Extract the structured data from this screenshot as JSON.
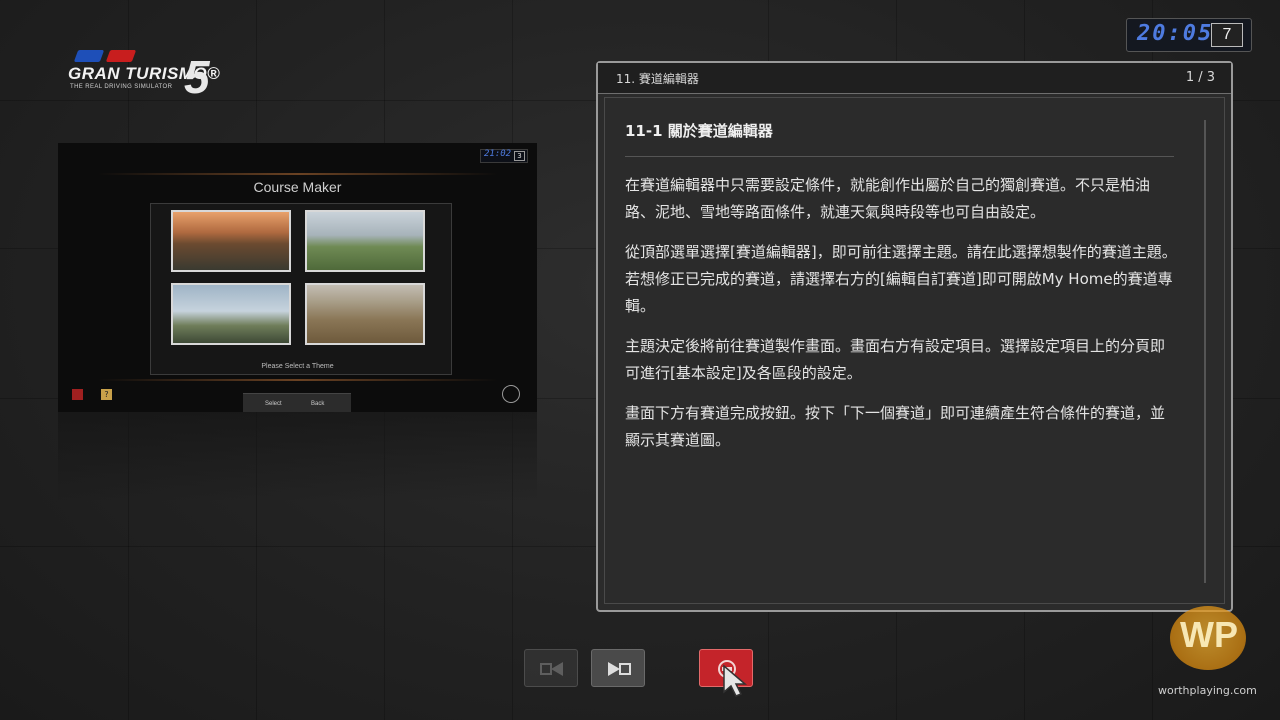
{
  "logo": {
    "brand": "GRAN TURISMO®",
    "subtitle": "THE REAL DRIVING SIMULATOR",
    "number": "5"
  },
  "clock": {
    "time": "20:05",
    "day": "7"
  },
  "preview": {
    "clock_time": "21:02",
    "clock_day": "3",
    "title": "Course Maker",
    "select_prompt": "Please Select a Theme",
    "help_icon": "?",
    "bottom_select": "Select",
    "bottom_back": "Back"
  },
  "panel": {
    "section_title": "11. 賽道編輯器",
    "page": "1 / 3",
    "heading": "11-1 關於賽道編輯器",
    "paragraphs": [
      "在賽道編輯器中只需要設定條件，就能創作出屬於自己的獨創賽道。不只是柏油路、泥地、雪地等路面條件，就連天氣與時段等也可自由設定。",
      "從頂部選單選擇[賽道編輯器]，即可前往選擇主題。請在此選擇想製作的賽道主題。若想修正已完成的賽道，請選擇右方的[編輯自訂賽道]即可開啟My Home的賽道專輯。",
      "主題決定後將前往賽道製作畫面。畫面右方有設定項目。選擇設定項目上的分頁即可進行[基本設定]及各區段的設定。",
      "畫面下方有賽道完成按鈕。按下「下一個賽道」即可連續產生符合條件的賽道，並顯示其賽道圖。"
    ]
  },
  "buttons": {
    "prev_icon": "prev-page-icon",
    "next_icon": "next-page-icon",
    "close_icon": "close-circle-icon"
  },
  "watermark": {
    "letters": "WP",
    "text": "worthplaying.com"
  },
  "colors": {
    "accent_blue": "#4e7be0",
    "close_red": "#c4242a",
    "panel_bg": "#2b2b2b"
  }
}
